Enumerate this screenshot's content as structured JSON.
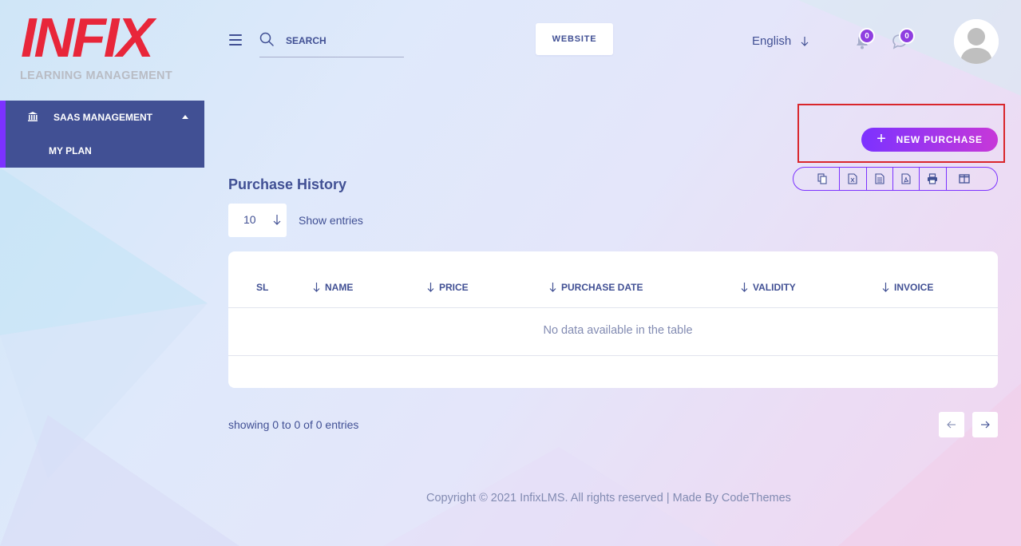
{
  "logo": {
    "wordmark": "INFIX",
    "subtitle": "LEARNING MANAGEMENT"
  },
  "sidebar": {
    "menu_label": "SAAS MANAGEMENT",
    "items": [
      {
        "label": "MY PLAN"
      }
    ]
  },
  "header": {
    "search_placeholder": "SEARCH",
    "website_label": "WEBSITE",
    "language": "English",
    "notifications_count": "0",
    "messages_count": "0"
  },
  "actions": {
    "new_purchase_label": "NEW PURCHASE",
    "export_buttons": [
      "copy-icon",
      "excel-icon",
      "csv-icon",
      "pdf-icon",
      "print-icon",
      "columns-icon"
    ]
  },
  "page": {
    "title": "Purchase History",
    "entries_value": "10",
    "entries_label": "Show entries"
  },
  "table": {
    "columns": [
      "SL",
      "NAME",
      "PRICE",
      "PURCHASE DATE",
      "VALIDITY",
      "INVOICE"
    ],
    "empty_message": "No data available in the table"
  },
  "pagination": {
    "info": "showing 0 to 0 of 0 entries"
  },
  "footer": {
    "copyright": "Copyright © 2021 InfixLMS. All rights reserved | Made By CodeThemes"
  },
  "colors": {
    "primary": "#415094",
    "accent": "#7c32ff",
    "accent_end": "#c738d8",
    "brand_red": "#e8263a",
    "highlight": "#d9262c"
  }
}
